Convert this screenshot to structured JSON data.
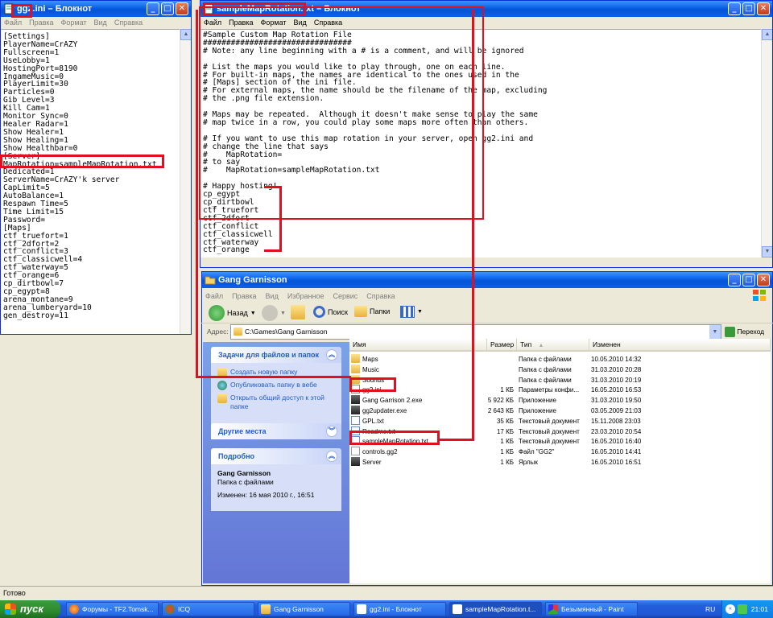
{
  "notepad_ini": {
    "title_file": "gg2.ini",
    "title_app": "Блокнот",
    "menu": [
      "Файл",
      "Правка",
      "Формат",
      "Вид",
      "Справка"
    ],
    "lines": [
      "[Settings]",
      "PlayerName=CrAZY",
      "Fullscreen=1",
      "UseLobby=1",
      "HostingPort=8190",
      "IngameMusic=0",
      "PlayerLimit=30",
      "Particles=0",
      "Gib Level=3",
      "Kill Cam=1",
      "Monitor Sync=0",
      "Healer Radar=1",
      "Show Healer=1",
      "Show Healing=1",
      "Show Healthbar=0",
      "[Server]",
      "MapRotation=sampleMapRotation.txt",
      "Dedicated=1",
      "ServerName=CrAZY'k server",
      "CapLimit=5",
      "AutoBalance=1",
      "Respawn Time=5",
      "Time Limit=15",
      "Password=",
      "[Maps]",
      "ctf_truefort=1",
      "ctf_2dfort=2",
      "ctf_conflict=3",
      "ctf_classicwell=4",
      "ctf_waterway=5",
      "ctf_orange=6",
      "cp_dirtbowl=7",
      "cp_egypt=8",
      "arena_montane=9",
      "arena_lumberyard=10",
      "gen_destroy=11"
    ]
  },
  "notepad_rotation": {
    "title_file": "sampleMapRotation.txt",
    "title_app": "Блокнот",
    "menu": [
      "Файл",
      "Правка",
      "Формат",
      "Вид",
      "Справка"
    ],
    "lines": [
      "#Sample Custom Map Rotation File",
      "################################",
      "# Note: any line beginning with a # is a comment, and will be ignored",
      "",
      "# List the maps you would like to play through, one on each line.",
      "# For built-in maps, the names are identical to the ones used in the",
      "# [Maps] section of the ini file.",
      "# For external maps, the name should be the filename of the map, excluding",
      "# the .png file extension.",
      "",
      "# Maps may be repeated.  Although it doesn't make sense to play the same",
      "# map twice in a row, you could play some maps more often than others.",
      "",
      "# If you want to use this map rotation in your server, open gg2.ini and",
      "# change the line that says",
      "#    MapRotation=",
      "# to say",
      "#    MapRotation=sampleMapRotation.txt",
      "",
      "# Happy hosting!",
      "cp_egypt",
      "cp_dirtbowl",
      "ctf_truefort",
      "ctf_2dfort",
      "ctf_conflict",
      "ctf_classicwell",
      "ctf_waterway",
      "ctf_orange"
    ]
  },
  "explorer": {
    "title": "Gang Garnisson",
    "menu": [
      "Файл",
      "Правка",
      "Вид",
      "Избранное",
      "Сервис",
      "Справка"
    ],
    "toolbar": {
      "back": "Назад",
      "search": "Поиск",
      "folders": "Папки"
    },
    "address_label": "Адрес:",
    "address_value": "C:\\Games\\Gang Garnisson",
    "go_label": "Переход",
    "tasks": {
      "head": "Задачи для файлов и папок",
      "items": [
        "Создать новую папку",
        "Опубликовать папку в вебе",
        "Открыть общий доступ к этой папке"
      ]
    },
    "places": {
      "head": "Другие места"
    },
    "details": {
      "head": "Подробно",
      "name": "Gang Garnisson",
      "type": "Папка с файлами",
      "modified": "Изменен: 16 мая 2010 г., 16:51"
    },
    "columns": [
      "Имя",
      "Размер",
      "Тип",
      "Изменен"
    ],
    "files": [
      {
        "name": "Maps",
        "size": "",
        "type": "Папка с файлами",
        "date": "10.05.2010 14:32",
        "icon": "folder"
      },
      {
        "name": "Music",
        "size": "",
        "type": "Папка с файлами",
        "date": "31.03.2010 20:28",
        "icon": "folder"
      },
      {
        "name": "Sounds",
        "size": "",
        "type": "Папка с файлами",
        "date": "31.03.2010 20:19",
        "icon": "folder"
      },
      {
        "name": "gg2.ini",
        "size": "1 КБ",
        "type": "Параметры конфи...",
        "date": "16.05.2010 16:53",
        "icon": "ini"
      },
      {
        "name": "Gang Garrison 2.exe",
        "size": "5 922 КБ",
        "type": "Приложение",
        "date": "31.03.2010 19:50",
        "icon": "exe"
      },
      {
        "name": "gg2updater.exe",
        "size": "2 643 КБ",
        "type": "Приложение",
        "date": "03.05.2009 21:03",
        "icon": "exe"
      },
      {
        "name": "GPL.txt",
        "size": "35 КБ",
        "type": "Текстовый документ",
        "date": "15.11.2008 23:03",
        "icon": "txt"
      },
      {
        "name": "Readme.txt",
        "size": "17 КБ",
        "type": "Текстовый документ",
        "date": "23.03.2010 20:54",
        "icon": "txt"
      },
      {
        "name": "sampleMapRotation.txt",
        "size": "1 КБ",
        "type": "Текстовый документ",
        "date": "16.05.2010 16:40",
        "icon": "txt"
      },
      {
        "name": "controls.gg2",
        "size": "1 КБ",
        "type": "Файл \"GG2\"",
        "date": "16.05.2010 14:41",
        "icon": "file"
      },
      {
        "name": "Server",
        "size": "1 КБ",
        "type": "Ярлык",
        "date": "16.05.2010 16:51",
        "icon": "exe"
      }
    ]
  },
  "statusbar": {
    "text": "Готово"
  },
  "taskbar": {
    "start": "пуск",
    "items": [
      "Форумы - TF2.Tomsk...",
      "ICQ",
      "Gang Garnisson",
      "gg2.ini - Блокнот",
      "sampleMapRotation.t...",
      "Безымянный - Paint"
    ],
    "lang": "RU",
    "clock": "21:01"
  },
  "colors": {
    "highlight": "#e0101e",
    "xp_blue": "#0a5fe6",
    "taskpane": "#6375d6"
  }
}
